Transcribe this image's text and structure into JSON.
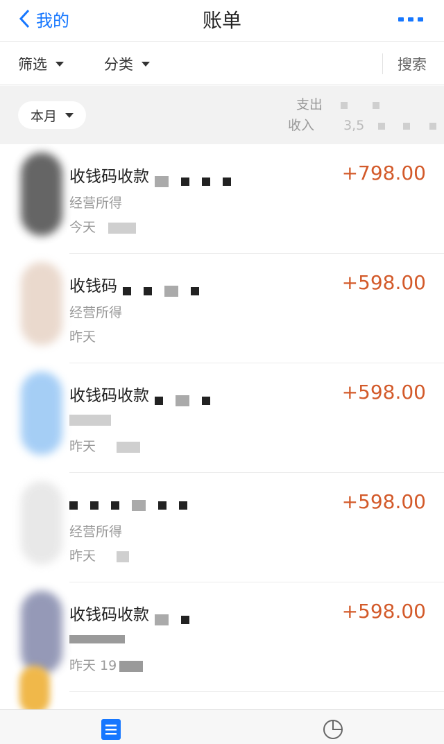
{
  "navbar": {
    "back_label": "我的",
    "title": "账单"
  },
  "filters": {
    "filter_label": "筛选",
    "category_label": "分类",
    "search_label": "搜索"
  },
  "month": {
    "label": "本月",
    "expense_label": "支出",
    "income_label": "收入",
    "income_value": "3,5"
  },
  "bills": [
    {
      "title": "收钱码收款",
      "category": "经营所得",
      "date": "今天",
      "amount": "+798.00"
    },
    {
      "title": "收钱码",
      "category": "经营所得",
      "date": "昨天",
      "amount": "+598.00"
    },
    {
      "title": "收钱码收款",
      "category": "",
      "date": "昨天",
      "amount": "+598.00"
    },
    {
      "title": "",
      "category": "经营所得",
      "date": "昨天",
      "amount": "+598.00"
    },
    {
      "title": "收钱码收款",
      "category": "",
      "date": "昨天 19",
      "amount": "+598.00"
    }
  ],
  "tabbar": {
    "items": [
      {
        "icon": "bill-list-icon",
        "active": true
      },
      {
        "icon": "pie-chart-icon",
        "active": false
      }
    ]
  },
  "colors": {
    "accent": "#1677ff",
    "amount": "#d35a2a"
  }
}
